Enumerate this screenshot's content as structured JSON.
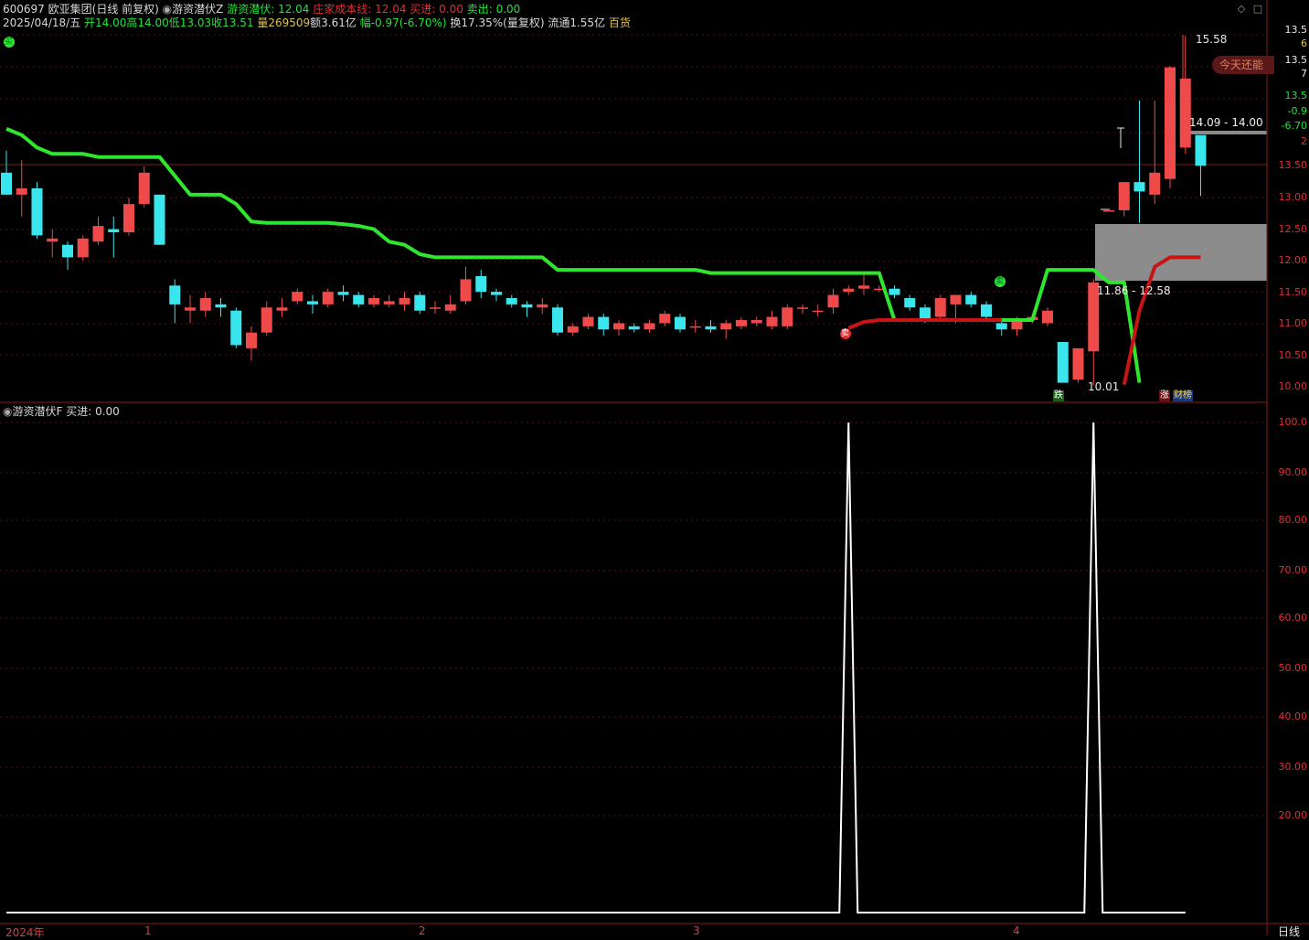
{
  "header": {
    "stock_code": "600697",
    "stock_name": "欧亚集团",
    "period": "(日线 前复权)",
    "indicator_name": "游资潜伏Z",
    "ind_label": "游资潜伏: 12.04",
    "cost_label": "庄家成本线: 12.04",
    "buy_label": "买进: 0.00",
    "sell_label": "卖出: 0.00",
    "date": "2025/04/18/五",
    "open": "开14.00",
    "high": "高14.00",
    "low": "低13.03",
    "close": "收13.51",
    "volume": "量269509",
    "amount": "额3.61亿",
    "change": "幅-0.97(-6.70%)",
    "turnover": "换17.35%(量复权)",
    "float": "流通1.55亿",
    "sector": "百货"
  },
  "annotations": {
    "high_label": "15.58",
    "low_label": "10.01",
    "zone_top": "14.09 - 14.00",
    "zone_bottom": "11.86 - 12.58",
    "today_tag": "今天还能",
    "down_tag": "跌",
    "up_tag": "涨",
    "finance_tag": "财榜",
    "buy_tag": "买",
    "sell_tag": "卖",
    "sell_tag2": "卖"
  },
  "price_axis": {
    "top_values": [
      "13.5",
      "6",
      "13.5",
      "7",
      "13.5",
      "-0.9",
      "-6.70",
      "2"
    ],
    "ticks": [
      "13.50",
      "13.00",
      "12.50",
      "12.00",
      "11.50",
      "11.00",
      "10.50",
      "10.00"
    ]
  },
  "lower_panel": {
    "title": "游资潜伏F",
    "buy_label": "买进: 0.00",
    "ticks": [
      "100.0",
      "90.00",
      "80.00",
      "70.00",
      "60.00",
      "50.00",
      "40.00",
      "30.00",
      "20.00"
    ]
  },
  "time_axis": {
    "labels": [
      "2024年",
      "1",
      "2",
      "3",
      "4"
    ],
    "period_label": "日线"
  },
  "colors": {
    "up": "#ef4a4a",
    "down": "#3ae6ee",
    "ind_line": "#2ee62e",
    "cost_line": "#c81414",
    "grid": "#5a1414",
    "zone": "#8c8c8c"
  },
  "chart_data": {
    "type": "candlestick",
    "price_range": [
      9.8,
      13.55
    ],
    "candles": [
      {
        "o": 13.4,
        "h": 13.75,
        "l": 13.05,
        "c": 13.05
      },
      {
        "o": 13.05,
        "h": 13.6,
        "l": 12.7,
        "c": 13.15
      },
      {
        "o": 13.15,
        "h": 13.25,
        "l": 12.35,
        "c": 12.4
      },
      {
        "o": 12.3,
        "h": 12.5,
        "l": 12.05,
        "c": 12.35
      },
      {
        "o": 12.25,
        "h": 12.3,
        "l": 11.85,
        "c": 12.05
      },
      {
        "o": 12.05,
        "h": 12.4,
        "l": 12.0,
        "c": 12.35
      },
      {
        "o": 12.3,
        "h": 12.7,
        "l": 12.25,
        "c": 12.55
      },
      {
        "o": 12.5,
        "h": 12.7,
        "l": 12.05,
        "c": 12.45
      },
      {
        "o": 12.45,
        "h": 13.0,
        "l": 12.4,
        "c": 12.9
      },
      {
        "o": 12.9,
        "h": 13.5,
        "l": 12.85,
        "c": 13.4
      },
      {
        "o": 13.05,
        "h": 13.05,
        "l": 12.25,
        "c": 12.25
      },
      {
        "o": 11.6,
        "h": 11.7,
        "l": 11.0,
        "c": 11.3
      },
      {
        "o": 11.2,
        "h": 11.45,
        "l": 11.0,
        "c": 11.25
      },
      {
        "o": 11.2,
        "h": 11.5,
        "l": 11.1,
        "c": 11.4
      },
      {
        "o": 11.3,
        "h": 11.4,
        "l": 11.1,
        "c": 11.25
      },
      {
        "o": 11.2,
        "h": 11.25,
        "l": 10.6,
        "c": 10.65
      },
      {
        "o": 10.6,
        "h": 10.95,
        "l": 10.4,
        "c": 10.85
      },
      {
        "o": 10.85,
        "h": 11.35,
        "l": 10.8,
        "c": 11.25
      },
      {
        "o": 11.2,
        "h": 11.4,
        "l": 11.1,
        "c": 11.25
      },
      {
        "o": 11.35,
        "h": 11.55,
        "l": 11.3,
        "c": 11.5
      },
      {
        "o": 11.35,
        "h": 11.45,
        "l": 11.15,
        "c": 11.3
      },
      {
        "o": 11.3,
        "h": 11.55,
        "l": 11.25,
        "c": 11.5
      },
      {
        "o": 11.5,
        "h": 11.6,
        "l": 11.35,
        "c": 11.45
      },
      {
        "o": 11.45,
        "h": 11.5,
        "l": 11.25,
        "c": 11.3
      },
      {
        "o": 11.3,
        "h": 11.45,
        "l": 11.25,
        "c": 11.4
      },
      {
        "o": 11.3,
        "h": 11.45,
        "l": 11.25,
        "c": 11.35
      },
      {
        "o": 11.3,
        "h": 11.5,
        "l": 11.2,
        "c": 11.4
      },
      {
        "o": 11.45,
        "h": 11.5,
        "l": 11.15,
        "c": 11.2
      },
      {
        "o": 11.25,
        "h": 11.35,
        "l": 11.15,
        "c": 11.25
      },
      {
        "o": 11.2,
        "h": 11.45,
        "l": 11.15,
        "c": 11.3
      },
      {
        "o": 11.35,
        "h": 11.9,
        "l": 11.3,
        "c": 11.7
      },
      {
        "o": 11.75,
        "h": 11.85,
        "l": 11.4,
        "c": 11.5
      },
      {
        "o": 11.5,
        "h": 11.55,
        "l": 11.35,
        "c": 11.45
      },
      {
        "o": 11.4,
        "h": 11.45,
        "l": 11.25,
        "c": 11.3
      },
      {
        "o": 11.3,
        "h": 11.35,
        "l": 11.1,
        "c": 11.25
      },
      {
        "o": 11.25,
        "h": 11.4,
        "l": 11.15,
        "c": 11.3
      },
      {
        "o": 11.25,
        "h": 11.3,
        "l": 10.8,
        "c": 10.85
      },
      {
        "o": 10.85,
        "h": 11.0,
        "l": 10.8,
        "c": 10.95
      },
      {
        "o": 10.95,
        "h": 11.15,
        "l": 10.9,
        "c": 11.1
      },
      {
        "o": 11.1,
        "h": 11.15,
        "l": 10.8,
        "c": 10.9
      },
      {
        "o": 10.9,
        "h": 11.05,
        "l": 10.8,
        "c": 11.0
      },
      {
        "o": 10.95,
        "h": 11.0,
        "l": 10.85,
        "c": 10.9
      },
      {
        "o": 10.9,
        "h": 11.05,
        "l": 10.85,
        "c": 11.0
      },
      {
        "o": 11.0,
        "h": 11.2,
        "l": 10.95,
        "c": 11.15
      },
      {
        "o": 11.1,
        "h": 11.15,
        "l": 10.85,
        "c": 10.9
      },
      {
        "o": 10.95,
        "h": 11.05,
        "l": 10.85,
        "c": 10.95
      },
      {
        "o": 10.95,
        "h": 11.05,
        "l": 10.85,
        "c": 10.9
      },
      {
        "o": 10.9,
        "h": 11.05,
        "l": 10.75,
        "c": 11.0
      },
      {
        "o": 10.95,
        "h": 11.1,
        "l": 10.9,
        "c": 11.05
      },
      {
        "o": 11.0,
        "h": 11.1,
        "l": 10.95,
        "c": 11.05
      },
      {
        "o": 10.95,
        "h": 11.2,
        "l": 10.9,
        "c": 11.1
      },
      {
        "o": 10.95,
        "h": 11.3,
        "l": 10.9,
        "c": 11.25
      },
      {
        "o": 11.25,
        "h": 11.3,
        "l": 11.15,
        "c": 11.25
      },
      {
        "o": 11.2,
        "h": 11.3,
        "l": 11.1,
        "c": 11.2
      },
      {
        "o": 11.25,
        "h": 11.55,
        "l": 11.15,
        "c": 11.45
      },
      {
        "o": 11.5,
        "h": 11.6,
        "l": 11.45,
        "c": 11.55
      },
      {
        "o": 11.55,
        "h": 11.8,
        "l": 11.45,
        "c": 11.6
      },
      {
        "o": 11.55,
        "h": 11.6,
        "l": 11.5,
        "c": 11.55
      },
      {
        "o": 11.55,
        "h": 11.6,
        "l": 11.4,
        "c": 11.45
      },
      {
        "o": 11.4,
        "h": 11.45,
        "l": 11.2,
        "c": 11.25
      },
      {
        "o": 11.25,
        "h": 11.3,
        "l": 11.0,
        "c": 11.05
      },
      {
        "o": 11.1,
        "h": 11.45,
        "l": 11.05,
        "c": 11.4
      },
      {
        "o": 11.3,
        "h": 11.45,
        "l": 11.0,
        "c": 11.45
      },
      {
        "o": 11.45,
        "h": 11.5,
        "l": 11.25,
        "c": 11.3
      },
      {
        "o": 11.3,
        "h": 11.35,
        "l": 11.05,
        "c": 11.1
      },
      {
        "o": 11.0,
        "h": 11.05,
        "l": 10.8,
        "c": 10.9
      },
      {
        "o": 10.9,
        "h": 11.1,
        "l": 10.8,
        "c": 11.05
      },
      {
        "o": 11.05,
        "h": 11.15,
        "l": 11.0,
        "c": 11.1
      },
      {
        "o": 11.0,
        "h": 11.25,
        "l": 10.95,
        "c": 11.2
      },
      {
        "o": 10.7,
        "h": 10.7,
        "l": 10.05,
        "c": 10.05
      },
      {
        "o": 10.1,
        "h": 10.6,
        "l": 10.05,
        "c": 10.6
      },
      {
        "o": 10.55,
        "h": 11.7,
        "l": 10.01,
        "c": 11.65
      },
      {
        "o": 12.8,
        "h": 12.8,
        "l": 12.8,
        "c": 12.8
      },
      {
        "o": 12.8,
        "h": 13.25,
        "l": 12.7,
        "c": 13.25
      },
      {
        "o": 13.25,
        "h": 14.55,
        "l": 12.6,
        "c": 13.1
      },
      {
        "o": 13.05,
        "h": 14.55,
        "l": 12.9,
        "c": 13.4
      },
      {
        "o": 13.3,
        "h": 15.1,
        "l": 13.15,
        "c": 15.08
      },
      {
        "o": 13.8,
        "h": 15.58,
        "l": 13.7,
        "c": 14.9
      },
      {
        "o": 14.0,
        "h": 14.0,
        "l": 13.03,
        "c": 13.51
      }
    ],
    "indicator_line": [
      14.1,
      14.0,
      13.8,
      13.7,
      13.7,
      13.7,
      13.65,
      13.65,
      13.65,
      13.65,
      13.65,
      13.35,
      13.05,
      13.05,
      13.05,
      12.9,
      12.62,
      12.6,
      12.6,
      12.6,
      12.6,
      12.6,
      12.58,
      12.55,
      12.5,
      12.3,
      12.25,
      12.1,
      12.05,
      12.05,
      12.05,
      12.05,
      12.05,
      12.05,
      12.05,
      12.05,
      11.85,
      11.85,
      11.85,
      11.85,
      11.85,
      11.85,
      11.85,
      11.85,
      11.85,
      11.85,
      11.8,
      11.8,
      11.8,
      11.8,
      11.8,
      11.8,
      11.8,
      11.8,
      11.8,
      11.8,
      11.8,
      11.8,
      11.05,
      11.05,
      11.05,
      11.05,
      11.05,
      11.05,
      11.05,
      11.05,
      11.05,
      11.05,
      11.85,
      11.85,
      11.85,
      11.85,
      11.65,
      11.65,
      10.05,
      null,
      null,
      null,
      null,
      null
    ],
    "cost_line": [
      null,
      null,
      null,
      null,
      null,
      null,
      null,
      null,
      null,
      null,
      null,
      null,
      null,
      null,
      null,
      null,
      null,
      null,
      null,
      null,
      null,
      null,
      null,
      null,
      null,
      null,
      null,
      null,
      null,
      null,
      null,
      null,
      null,
      null,
      null,
      null,
      null,
      null,
      null,
      null,
      null,
      null,
      null,
      null,
      null,
      null,
      null,
      null,
      null,
      null,
      null,
      null,
      null,
      null,
      null,
      10.92,
      11.02,
      11.05,
      11.05,
      11.05,
      11.05,
      11.05,
      11.05,
      11.05,
      11.05,
      11.05,
      null,
      null,
      null,
      null,
      null,
      null,
      null,
      10.02,
      11.2,
      11.9,
      12.05,
      12.05,
      12.05,
      12.05,
      12.05
    ],
    "lower_series": {
      "name": "游资潜伏F",
      "ylim": [
        0,
        100
      ],
      "values": [
        0,
        0,
        0,
        0,
        0,
        0,
        0,
        0,
        0,
        0,
        0,
        0,
        0,
        0,
        0,
        0,
        0,
        0,
        0,
        0,
        0,
        0,
        0,
        0,
        0,
        0,
        0,
        0,
        0,
        0,
        0,
        0,
        0,
        0,
        0,
        0,
        0,
        0,
        0,
        0,
        0,
        0,
        0,
        0,
        0,
        0,
        0,
        0,
        0,
        0,
        0,
        0,
        0,
        0,
        0,
        100,
        0,
        0,
        0,
        0,
        0,
        0,
        0,
        0,
        0,
        0,
        0,
        0,
        0,
        0,
        0,
        100,
        0,
        0,
        0,
        0,
        0,
        0
      ]
    }
  }
}
